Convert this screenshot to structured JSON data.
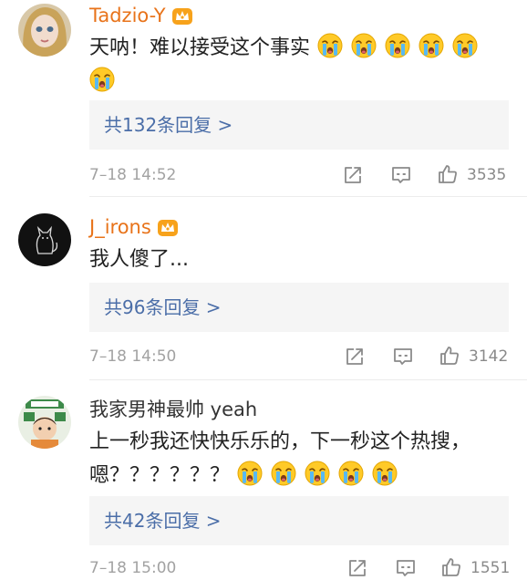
{
  "comments": [
    {
      "username": "Tadzio-Y",
      "vip": true,
      "text": "天呐！难以接受这个事实",
      "emoji_count": 6,
      "reply_label": "共132条回复 >",
      "time": "7–18 14:52",
      "likes": "3535"
    },
    {
      "username": "J_irons",
      "vip": true,
      "text": "我人傻了...",
      "emoji_count": 0,
      "reply_label": "共96条回复 >",
      "time": "7–18 14:50",
      "likes": "3142"
    },
    {
      "username": "我家男神最帅 yeah",
      "vip": false,
      "text_line1": "上一秒我还快快乐乐的，下一秒这个热搜，",
      "text_line2": "嗯？？？？？？",
      "emoji_count": 5,
      "reply_label": "共42条回复 >",
      "time": "7–18 15:00",
      "likes": "1551"
    }
  ],
  "icons": {
    "crown": "crown-icon",
    "share": "share-icon",
    "comment": "comment-icon",
    "like": "like-icon",
    "emoji": "crying-emoji-icon"
  },
  "colors": {
    "vip_name": "#e8731a",
    "reply_link": "#4b6ea8",
    "reply_bg": "#f5f5f5",
    "meta": "#a2a2a2"
  }
}
